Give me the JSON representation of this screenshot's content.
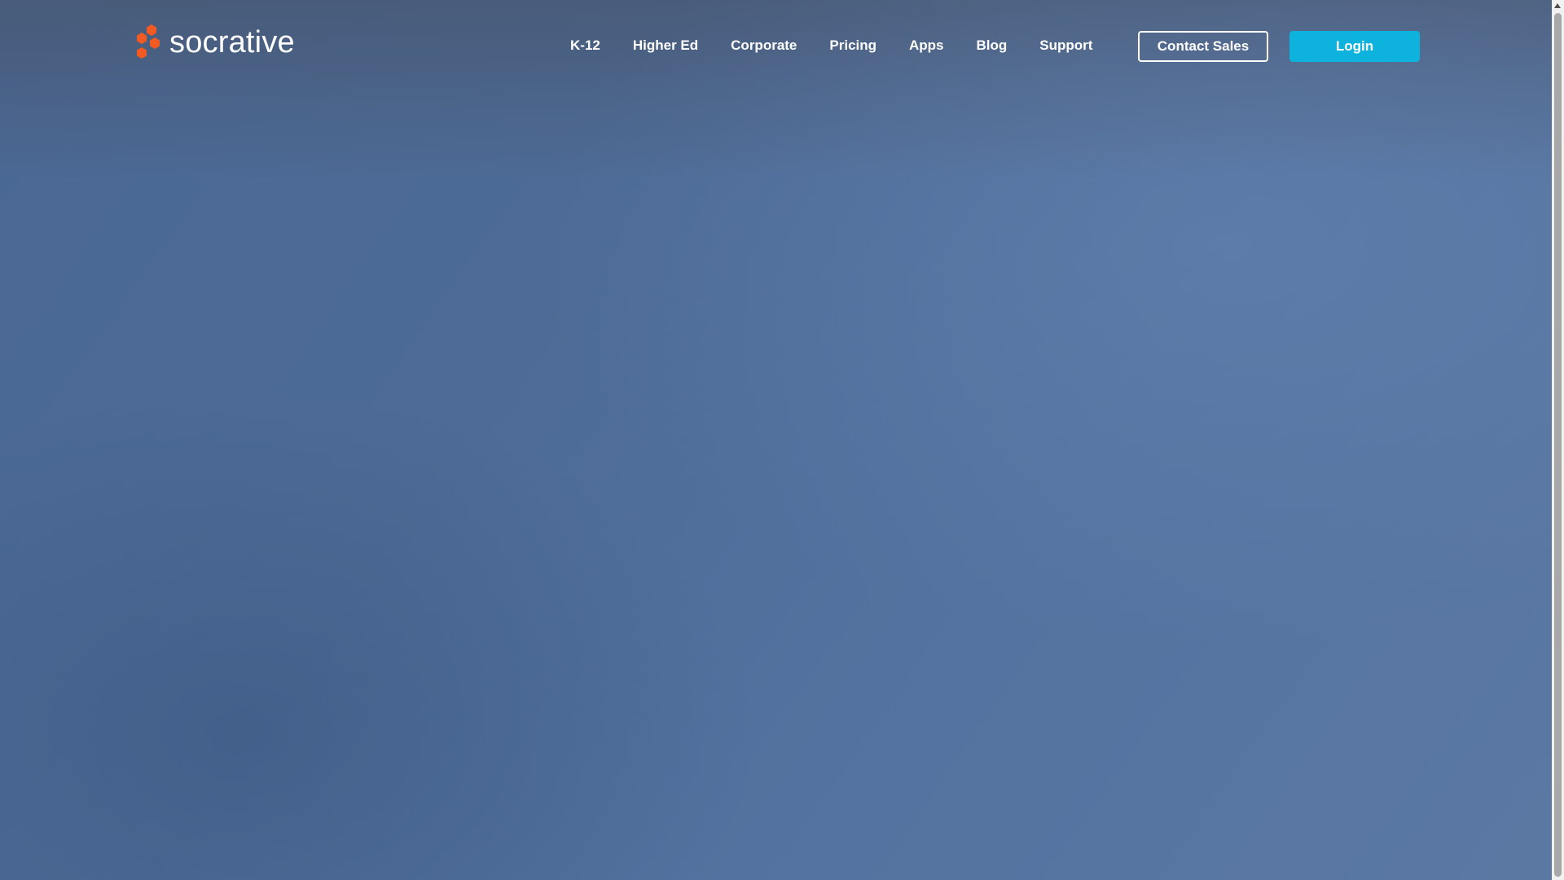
{
  "brand": {
    "name": "socrative",
    "logo_color": "#f15a22"
  },
  "nav": {
    "items": [
      {
        "label": "K-12"
      },
      {
        "label": "Higher Ed"
      },
      {
        "label": "Corporate"
      },
      {
        "label": "Pricing"
      },
      {
        "label": "Apps"
      },
      {
        "label": "Blog"
      },
      {
        "label": "Support"
      }
    ]
  },
  "actions": {
    "contact_label": "Contact Sales",
    "login_label": "Login"
  },
  "colors": {
    "accent": "#0db3dd",
    "background": "#4d6b96"
  },
  "icons": {
    "logo": "hexagon-cluster-logo-icon",
    "scroll_up": "chevron-up-icon"
  }
}
